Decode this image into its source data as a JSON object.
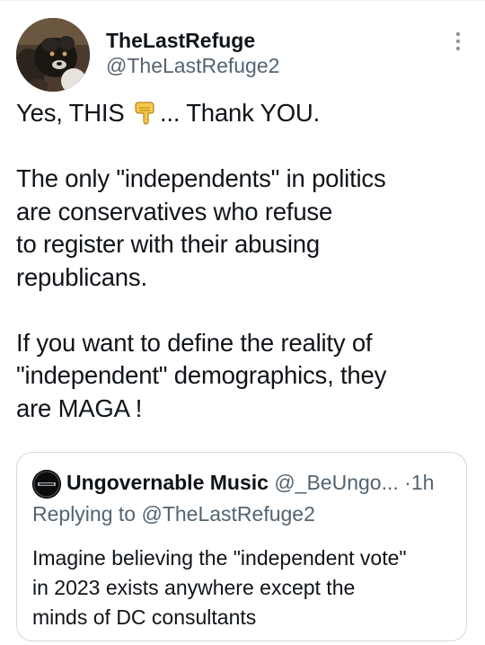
{
  "tweet": {
    "author": {
      "display_name": "TheLastRefuge",
      "handle": "@TheLastRefuge2",
      "avatar": "dog-avatar"
    },
    "more_icon": "more-vertical-icon",
    "body_lines": [
      {
        "before": "Yes, THIS ",
        "icon": "backhand-index-pointing-down-emoji",
        "after": "... Thank YOU."
      },
      "",
      "The only \"independents\" in politics",
      "are conservatives who refuse",
      "to register with their abusing",
      "republicans.",
      "",
      "If you want to define the reality of",
      "\"independent\" demographics, they",
      "are MAGA !"
    ]
  },
  "quote": {
    "display_name": "Ungovernable Music",
    "handle": "@_BeUngo...",
    "separator": "·",
    "time": "1h",
    "replying_prefix": "Replying to ",
    "replying_handle": "@TheLastRefuge2",
    "text_lines": [
      "Imagine believing the \"independent vote\"",
      "in 2023 exists anywhere except the",
      "minds of DC consultants"
    ]
  },
  "colors": {
    "text": "#0f1419",
    "secondary": "#536471",
    "border": "#cfd9de",
    "emoji_skin": "#f5c84a"
  }
}
